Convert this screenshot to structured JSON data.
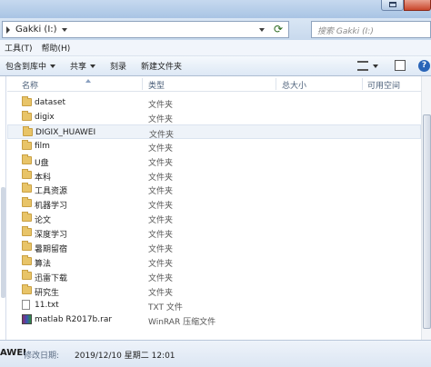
{
  "address": {
    "crumb": "Gakki (I:)"
  },
  "search": {
    "placeholder": "搜索 Gakki (I:)"
  },
  "menubar": [
    "工具(T)",
    "帮助(H)"
  ],
  "toolbar": {
    "include": "包含到库中",
    "share": "共享",
    "burn": "刻录",
    "new_folder": "新建文件夹",
    "help_icon": "?"
  },
  "columns": {
    "name": "名称",
    "type": "类型",
    "size": "总大小",
    "free": "可用空间"
  },
  "files": [
    {
      "name": "dataset",
      "type": "文件夹",
      "icon": "folder"
    },
    {
      "name": "digix",
      "type": "文件夹",
      "icon": "folder"
    },
    {
      "name": "DIGIX_HUAWEI",
      "type": "文件夹",
      "icon": "folder",
      "selected": true
    },
    {
      "name": "film",
      "type": "文件夹",
      "icon": "folder"
    },
    {
      "name": "U盘",
      "type": "文件夹",
      "icon": "folder"
    },
    {
      "name": "本科",
      "type": "文件夹",
      "icon": "folder"
    },
    {
      "name": "工具资源",
      "type": "文件夹",
      "icon": "folder"
    },
    {
      "name": "机器学习",
      "type": "文件夹",
      "icon": "folder"
    },
    {
      "name": "论文",
      "type": "文件夹",
      "icon": "folder"
    },
    {
      "name": "深度学习",
      "type": "文件夹",
      "icon": "folder"
    },
    {
      "name": "暑期留宿",
      "type": "文件夹",
      "icon": "folder"
    },
    {
      "name": "算法",
      "type": "文件夹",
      "icon": "folder"
    },
    {
      "name": "迅雷下载",
      "type": "文件夹",
      "icon": "folder"
    },
    {
      "name": "研究生",
      "type": "文件夹",
      "icon": "folder"
    },
    {
      "name": "11.txt",
      "type": "TXT 文件",
      "icon": "txt"
    },
    {
      "name": "matlab R2017b.rar",
      "type": "WinRAR 压缩文件",
      "icon": "rar"
    }
  ],
  "status": {
    "name": "AWEI",
    "label": "修改日期:",
    "value": "2019/12/10 星期二 12:01"
  }
}
